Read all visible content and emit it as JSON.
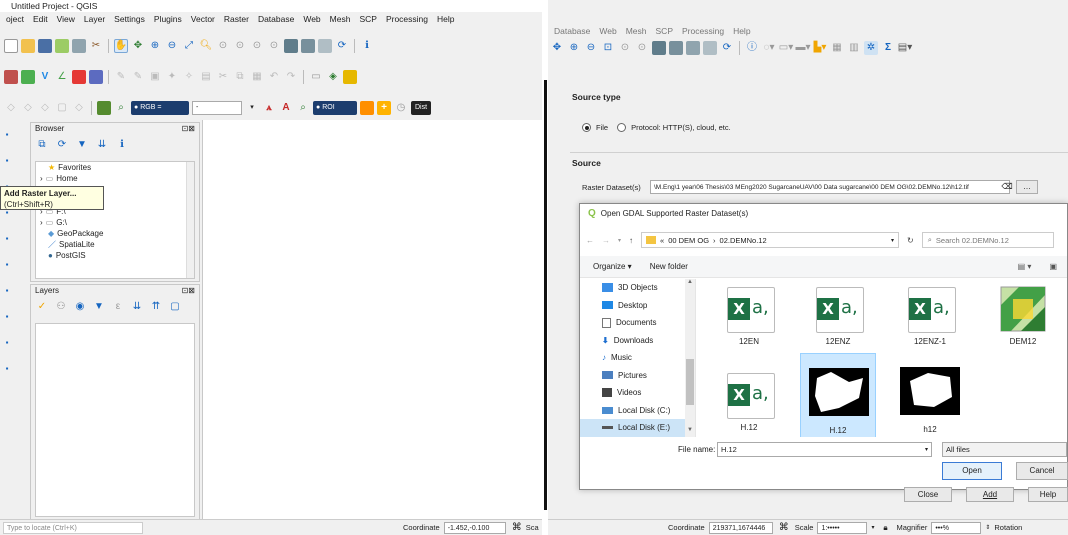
{
  "left": {
    "title": "Untitled Project - QGIS",
    "menu": [
      "oject",
      "Edit",
      "View",
      "Layer",
      "Settings",
      "Plugins",
      "Vector",
      "Raster",
      "Database",
      "Web",
      "Mesh",
      "SCP",
      "Processing",
      "Help"
    ],
    "toolbar": {
      "rgb_label": "RGB =",
      "roi_label": "ROI",
      "dist_label": "Dist",
      "band_value": "-"
    },
    "tooltip": {
      "title": "Add Raster Layer...",
      "shortcut": "(Ctrl+Shift+R)"
    },
    "browser": {
      "title": "Browser",
      "items": [
        {
          "label": "Favorites",
          "icon": "star-icon"
        },
        {
          "label": "Home",
          "icon": "folder-icon"
        },
        {
          "label": "F:\\",
          "icon": "drive-icon"
        },
        {
          "label": "G:\\",
          "icon": "drive-icon"
        },
        {
          "label": "GeoPackage",
          "icon": "geopackage-icon"
        },
        {
          "label": "SpatiaLite",
          "icon": "spatialite-icon"
        },
        {
          "label": "PostGIS",
          "icon": "postgis-icon"
        }
      ]
    },
    "layers": {
      "title": "Layers"
    },
    "status": {
      "locate_placeholder": "Type to locate (Ctrl+K)",
      "coordinate_label": "Coordinate",
      "coordinate_value": "-1.452,-0.100",
      "scale_label": "Sca"
    }
  },
  "right": {
    "menu": [
      "Database",
      "Web",
      "Mesh",
      "SCP",
      "Processing",
      "Help"
    ],
    "source_type": {
      "heading": "Source type",
      "file_label": "File",
      "protocol_label": "Protocol: HTTP(S), cloud, etc."
    },
    "source": {
      "heading": "Source",
      "raster_label": "Raster Dataset(s)",
      "raster_value": "\\M.Eng\\1 year\\06 Thesis\\03 MEng2020 SugarcaneUAV\\00 Data sugarcane\\00 DEM OG\\02.DEMNo.12\\h12.tif"
    },
    "file_dialog": {
      "title": "Open GDAL Supported Raster Dataset(s)",
      "breadcrumb": [
        "«",
        "00 DEM OG",
        "›",
        "02.DEMNo.12"
      ],
      "search_placeholder": "Search 02.DEMNo.12",
      "organize_label": "Organize ▾",
      "new_folder_label": "New folder",
      "nav_items": [
        {
          "label": "3D Objects",
          "icon": "cube-icon",
          "color": "#3a8ee6"
        },
        {
          "label": "Desktop",
          "icon": "desktop-icon",
          "color": "#1e88e5"
        },
        {
          "label": "Documents",
          "icon": "documents-icon",
          "color": "#777777"
        },
        {
          "label": "Downloads",
          "icon": "download-icon",
          "color": "#1e6fd0"
        },
        {
          "label": "Music",
          "icon": "music-icon",
          "color": "#1e6fd0"
        },
        {
          "label": "Pictures",
          "icon": "pictures-icon",
          "color": "#4b7fbf"
        },
        {
          "label": "Videos",
          "icon": "videos-icon",
          "color": "#444444"
        },
        {
          "label": "Local Disk (C:)",
          "icon": "disk-icon",
          "color": "#4a8cd0"
        },
        {
          "label": "Local Disk (E:)",
          "icon": "disk-icon",
          "color": "#777777"
        }
      ],
      "files": [
        {
          "label": "12EN",
          "kind": "excel"
        },
        {
          "label": "12ENZ",
          "kind": "excel"
        },
        {
          "label": "12ENZ-1",
          "kind": "excel"
        },
        {
          "label": "DEM12",
          "kind": "map"
        },
        {
          "label": "H.12",
          "kind": "excel"
        },
        {
          "label": "H.12",
          "kind": "raster"
        },
        {
          "label": "h12",
          "kind": "raster2"
        }
      ],
      "filename_label": "File name:",
      "filename_value": "H.12",
      "filter_value": "All files",
      "open_label": "Open",
      "cancel_label": "Cancel"
    },
    "dialog_buttons": {
      "close": "Close",
      "add": "Add",
      "help": "Help"
    },
    "status": {
      "coordinate_label": "Coordinate",
      "coordinate_value": "219371,1674446",
      "scale_label": "Scale",
      "scale_value": "1:•••••",
      "magnifier_label": "Magnifier",
      "magnifier_value": "•••%",
      "rotation_label": "Rotation"
    }
  }
}
